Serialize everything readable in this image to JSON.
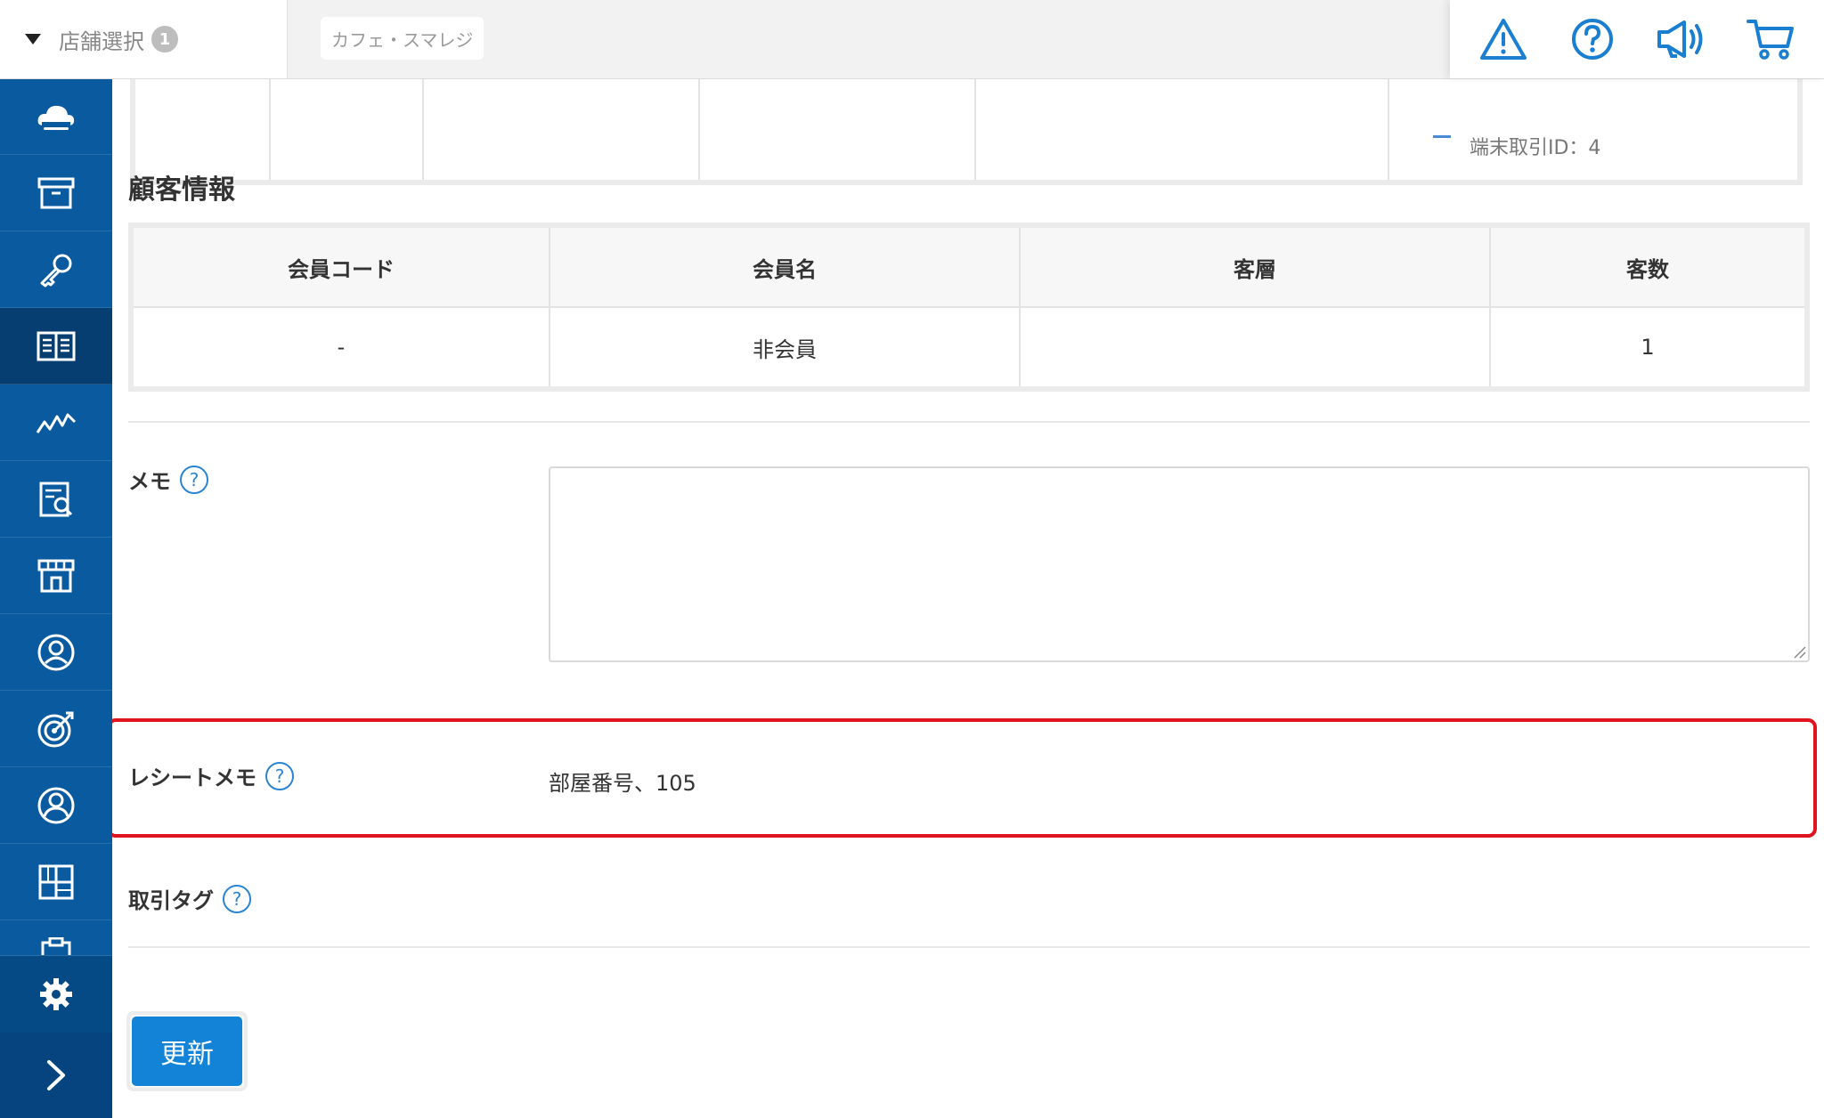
{
  "header": {
    "store_select_label": "店舗選択",
    "store_select_count": "1",
    "current_store": "カフェ・スマレジ",
    "icons": [
      "warning-icon",
      "help-icon",
      "megaphone-icon",
      "cart-icon"
    ],
    "accent_color": "#1a7fd1"
  },
  "sidebar": {
    "background_color": "#0a5aa0",
    "items": [
      {
        "icon": "cloud-icon"
      },
      {
        "icon": "archive-box-icon"
      },
      {
        "icon": "key-icon"
      },
      {
        "icon": "book-icon",
        "active": true
      },
      {
        "icon": "line-chart-icon"
      },
      {
        "icon": "report-search-icon"
      },
      {
        "icon": "storefront-icon"
      },
      {
        "icon": "staff-badge-icon"
      },
      {
        "icon": "target-icon"
      },
      {
        "icon": "customer-icon"
      },
      {
        "icon": "grid-apps-icon"
      },
      {
        "icon": "clipboard-icon"
      }
    ],
    "settings_icon": "gear-icon",
    "expand_icon": "chevron-right-icon"
  },
  "top_table": {
    "cut_off_text": "端末取引ID：4"
  },
  "customer_section": {
    "title": "顧客情報",
    "columns": [
      "会員コード",
      "会員名",
      "客層",
      "客数"
    ],
    "rows": [
      [
        "-",
        "非会員",
        "",
        "1"
      ]
    ]
  },
  "memo": {
    "label": "メモ",
    "help": "?",
    "value": ""
  },
  "receipt_memo": {
    "label": "レシートメモ",
    "help": "?",
    "value": "部屋番号、105",
    "highlight_color": "#e0141e"
  },
  "transaction_tag": {
    "label": "取引タグ",
    "help": "?"
  },
  "actions": {
    "update_label": "更新"
  }
}
